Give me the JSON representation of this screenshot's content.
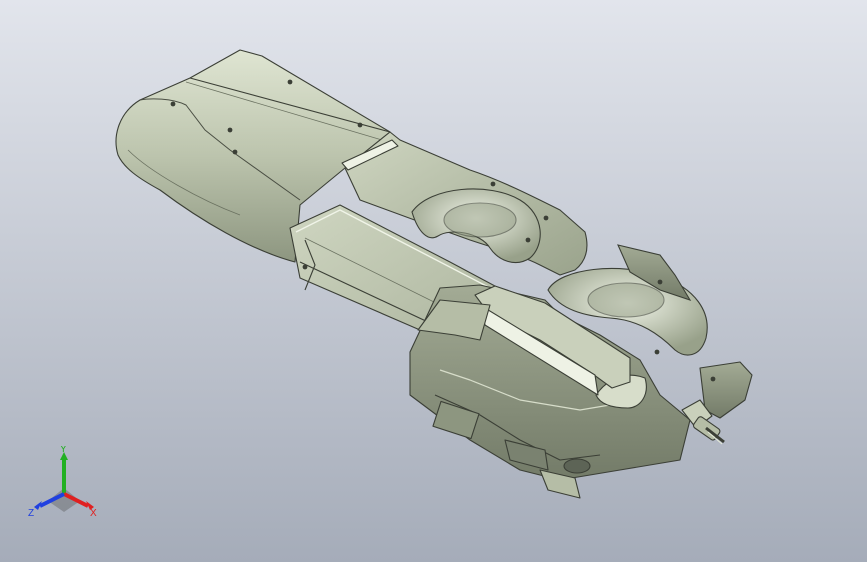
{
  "viewport": {
    "background_top": "#e2e5ec",
    "background_bottom": "#a5acb9"
  },
  "model": {
    "body_color": "#bfc7b0",
    "shade_color": "#8f9882",
    "highlight_color": "#e6ecd9",
    "edge_color": "#3b3f36"
  },
  "triad": {
    "x_label": "X",
    "y_label": "Y",
    "z_label": "Z",
    "x_color": "#e02020",
    "y_color": "#22b022",
    "z_color": "#2040e0"
  }
}
